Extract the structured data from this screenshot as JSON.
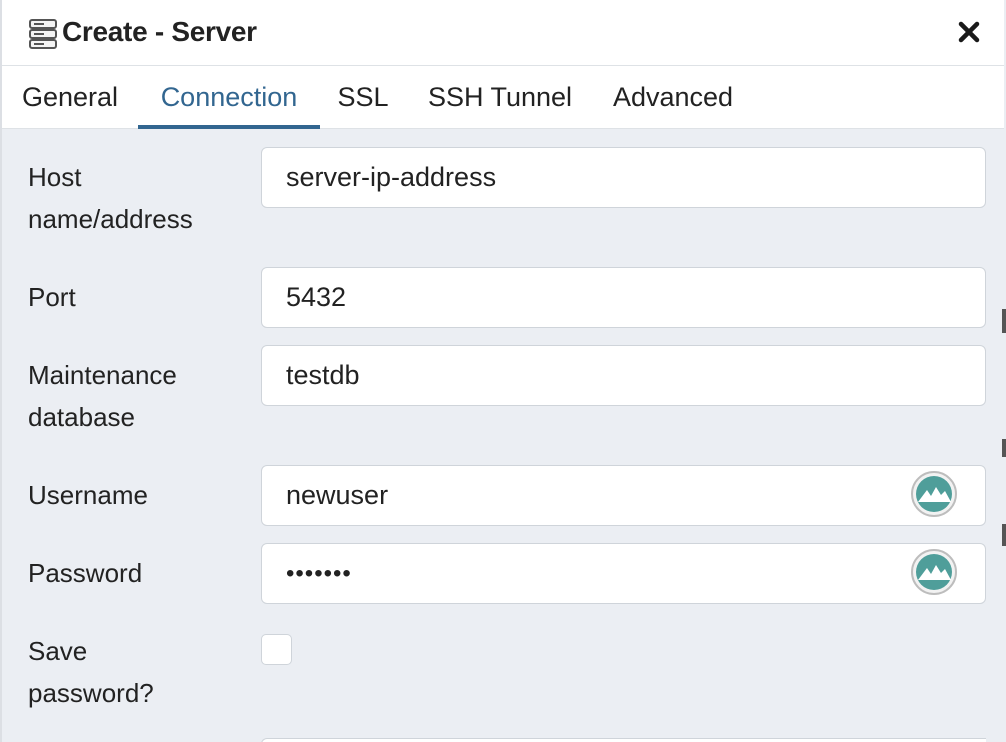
{
  "dialog": {
    "title": "Create - Server",
    "title_icon": "server-icon",
    "close_icon": "close-icon"
  },
  "tabs": [
    {
      "label": "General",
      "active": false
    },
    {
      "label": "Connection",
      "active": true
    },
    {
      "label": "SSL",
      "active": false
    },
    {
      "label": "SSH Tunnel",
      "active": false
    },
    {
      "label": "Advanced",
      "active": false
    }
  ],
  "form": {
    "host": {
      "label_line1": "Host",
      "label_line2": "name/address",
      "value": "server-ip-address"
    },
    "port": {
      "label": "Port",
      "value": "5432"
    },
    "maintenance_db": {
      "label_line1": "Maintenance",
      "label_line2": "database",
      "value": "testdb"
    },
    "username": {
      "label": "Username",
      "value": "newuser",
      "addon_icon": "password-manager-icon"
    },
    "password": {
      "label": "Password",
      "value": "•••••••",
      "addon_icon": "password-manager-icon"
    },
    "save_password": {
      "label_line1": "Save",
      "label_line2": "password?",
      "checked": false
    }
  },
  "colors": {
    "accent": "#326690",
    "background": "#ebeef3",
    "pm_icon": "#4f9e9a"
  }
}
